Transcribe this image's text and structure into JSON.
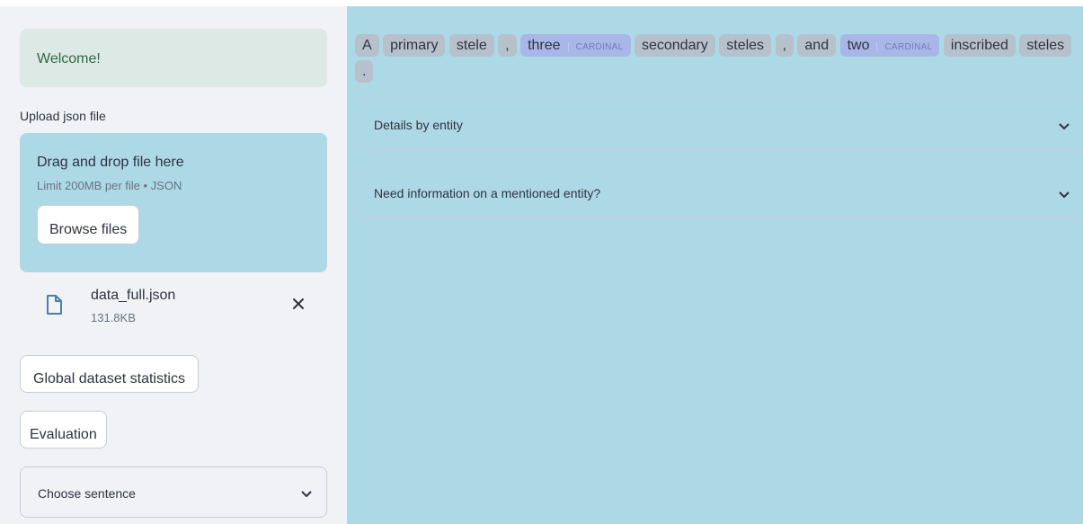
{
  "sidebar": {
    "welcome": "Welcome!",
    "upload_label": "Upload json file",
    "dropzone": {
      "title": "Drag and drop file here",
      "subtitle": "Limit 200MB per file • JSON",
      "browse_label": "Browse files"
    },
    "file": {
      "name": "data_full.json",
      "size": "131.8KB",
      "icon": "file-icon"
    },
    "global_stats_label": "Global dataset statistics",
    "evaluation_label": "Evaluation",
    "choose_sentence_placeholder": "Choose sentence"
  },
  "main": {
    "tokens": [
      {
        "text": "A"
      },
      {
        "text": "primary"
      },
      {
        "text": "stele"
      },
      {
        "text": ","
      },
      {
        "text": "three",
        "label": "CARDINAL"
      },
      {
        "text": "secondary"
      },
      {
        "text": "steles"
      },
      {
        "text": ","
      },
      {
        "text": "and"
      },
      {
        "text": "two",
        "label": "CARDINAL"
      },
      {
        "text": "inscribed"
      },
      {
        "text": "steles"
      },
      {
        "text": "."
      }
    ],
    "expanders": [
      {
        "label": "Details by entity"
      },
      {
        "label": "Need information on a mentioned entity?"
      }
    ]
  },
  "colors": {
    "sidebar_bg": "#f0f2f6",
    "main_bg": "#add8e6",
    "token_bg": "#b7c1cc",
    "entity_bg": "#a9b7e8",
    "alert_bg": "#dde9e5",
    "alert_text": "#2f6b41"
  }
}
